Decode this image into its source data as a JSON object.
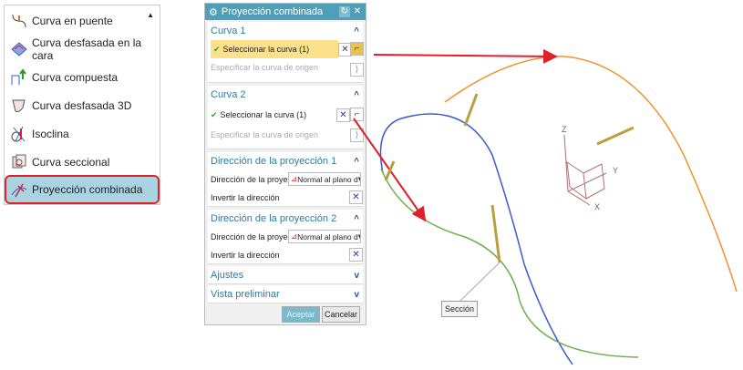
{
  "menu": {
    "items": [
      {
        "label": "Curva en puente",
        "icon": "bridge-curve-icon"
      },
      {
        "label": "Curva desfasada en la cara",
        "icon": "offset-in-face-icon"
      },
      {
        "label": "Curva compuesta",
        "icon": "composite-curve-icon"
      },
      {
        "label": "Curva desfasada 3D",
        "icon": "offset-3d-icon"
      },
      {
        "label": "Isoclina",
        "icon": "isocline-icon"
      },
      {
        "label": "Curva seccional",
        "icon": "section-curve-icon"
      },
      {
        "label": "Proyección combinada",
        "icon": "combined-projection-icon",
        "selected": true
      }
    ]
  },
  "dialog": {
    "title": "Proyección combinada",
    "curva1": {
      "header": "Curva 1",
      "select": "Seleccionar la curva (1)",
      "origin": "Especificar la curva de origen"
    },
    "curva2": {
      "header": "Curva 2",
      "select": "Seleccionar la curva (1)",
      "origin": "Especificar la curva de origen"
    },
    "dir1": {
      "header": "Dirección de la proyección 1",
      "label": "Dirección de la proyecció",
      "value": "Normal al plano d",
      "invert": "Invertir la dirección"
    },
    "dir2": {
      "header": "Dirección de la proyección 2",
      "label": "Dirección de la proyecció",
      "value": "Normal al plano d",
      "invert": "Invertir la dirección"
    },
    "ajustes": "Ajustes",
    "vista": "Vista preliminar",
    "ok": "Aceptar",
    "cancel": "Cancelar"
  },
  "viewport": {
    "section_label": "Sección",
    "axes": {
      "x": "X",
      "y": "Y",
      "z": "Z"
    },
    "colors": {
      "curve1": "#f0922e",
      "curve2": "#3a5ad0",
      "curve3": "#6ab04c",
      "arrow": "#e0202a",
      "vector": "#b8a040"
    }
  }
}
